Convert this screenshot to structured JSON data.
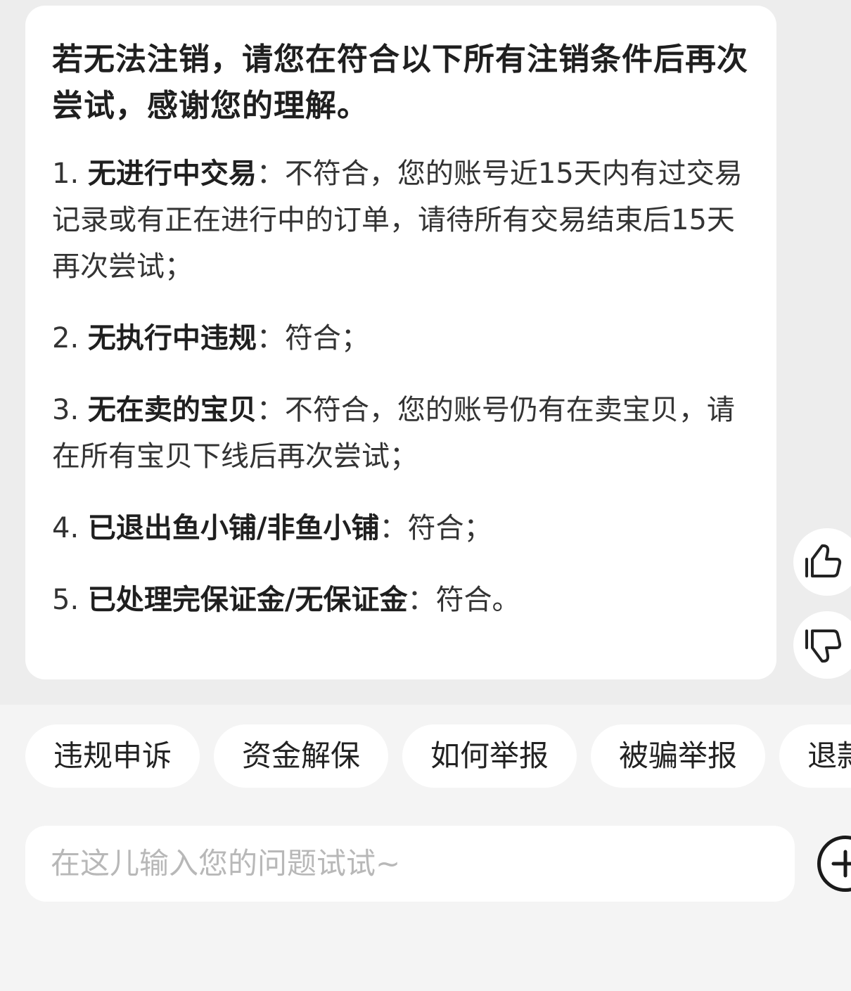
{
  "message": {
    "intro": "若无法注销，请您在符合以下所有注销条件后再次尝试，感谢您的理解。",
    "conditions": [
      {
        "num": "1. ",
        "title": "无进行中交易",
        "detail": "：不符合，您的账号近15天内有过交易记录或有正在进行中的订单，请待所有交易结束后15天再次尝试；"
      },
      {
        "num": "2. ",
        "title": "无执行中违规",
        "detail": "：符合；"
      },
      {
        "num": "3. ",
        "title": "无在卖的宝贝",
        "detail": "：不符合，您的账号仍有在卖宝贝，请在所有宝贝下线后再次尝试；"
      },
      {
        "num": "4. ",
        "title": "已退出鱼小铺/非鱼小铺",
        "detail": "：符合；"
      },
      {
        "num": "5. ",
        "title": "已处理完保证金/无保证金",
        "detail": "：符合。"
      }
    ]
  },
  "feedback": {
    "like_icon": "thumbs-up-icon",
    "dislike_icon": "thumbs-down-icon"
  },
  "quick_replies": [
    "违规申诉",
    "资金解保",
    "如何举报",
    "被骗举报",
    "退款"
  ],
  "input": {
    "placeholder": "在这儿输入您的问题试试~",
    "value": ""
  },
  "icons": {
    "plus": "plus-circle-icon"
  },
  "colors": {
    "chat_background": "#ededed",
    "bubble": "#ffffff",
    "bottom_background": "#f4f4f4",
    "text": "#222222",
    "placeholder": "#b8b8b8"
  }
}
